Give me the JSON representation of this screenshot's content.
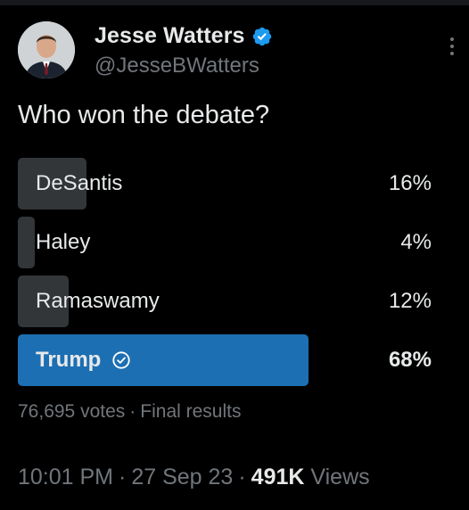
{
  "author": {
    "display_name": "Jesse Watters",
    "handle": "@JesseBWatters"
  },
  "post": {
    "text": "Who won the debate?"
  },
  "poll": {
    "options": [
      {
        "label": "DeSantis",
        "percent_label": "16%",
        "percent": 16
      },
      {
        "label": "Haley",
        "percent_label": "4%",
        "percent": 4
      },
      {
        "label": "Ramaswamy",
        "percent_label": "12%",
        "percent": 12
      },
      {
        "label": "Trump",
        "percent_label": "68%",
        "percent": 68,
        "winner": true
      }
    ],
    "votes_label": "76,695 votes",
    "status": "Final results"
  },
  "meta": {
    "time": "10:01 PM",
    "date": "27 Sep 23",
    "views_count": "491K",
    "views_label": "Views"
  },
  "colors": {
    "background": "#000000",
    "bar": "#333639",
    "winner_bar": "#1d6fb3",
    "verified": "#1d9bf0",
    "secondary_text": "#71767b"
  },
  "icons": [
    "verified-badge-icon",
    "more-options-icon",
    "winner-check-icon"
  ]
}
